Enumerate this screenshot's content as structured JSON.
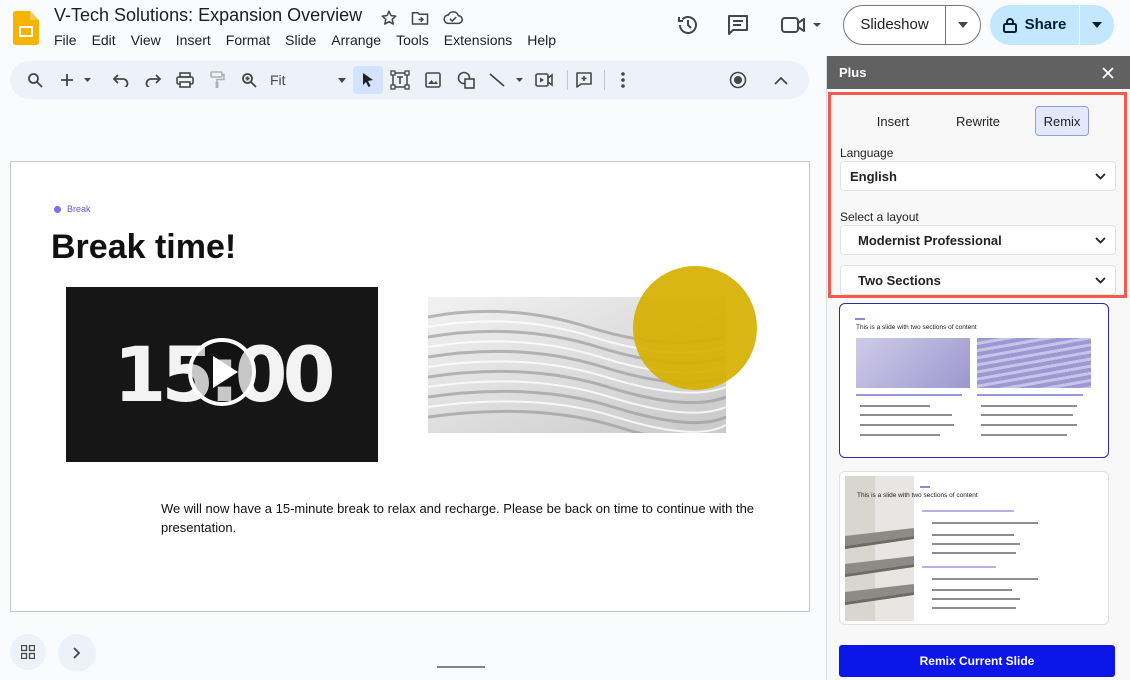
{
  "header": {
    "doc_title": "V-Tech Solutions: Expansion Overview",
    "menu": [
      "File",
      "Edit",
      "View",
      "Insert",
      "Format",
      "Slide",
      "Arrange",
      "Tools",
      "Extensions",
      "Help"
    ],
    "slideshow_label": "Slideshow",
    "share_label": "Share"
  },
  "toolbar": {
    "zoom_value": "Fit"
  },
  "slide": {
    "tag": "Break",
    "title": "Break time!",
    "timer": "15:00",
    "body": "We will now have a 15-minute break to relax and recharge. Please be back on time to continue with the presentation."
  },
  "panel": {
    "title": "Plus",
    "tabs": [
      "Insert",
      "Rewrite",
      "Remix"
    ],
    "active_tab": "Remix",
    "language_label": "Language",
    "language_value": "English",
    "layout_label": "Select a layout",
    "theme_value": "Modernist Professional",
    "layout_value": "Two Sections",
    "preview_1_title": "This is a slide with two sections of content",
    "preview_2_title": "This is a slide with two sections of content",
    "remix_button": "Remix Current Slide"
  },
  "colors": {
    "share_bg": "#c2e7ff",
    "remix_button_bg": "#0c16e8",
    "highlight_border": "#ef5b4f",
    "accent_purple": "#7a6ff0",
    "circle_yellow": "#d6b000"
  }
}
